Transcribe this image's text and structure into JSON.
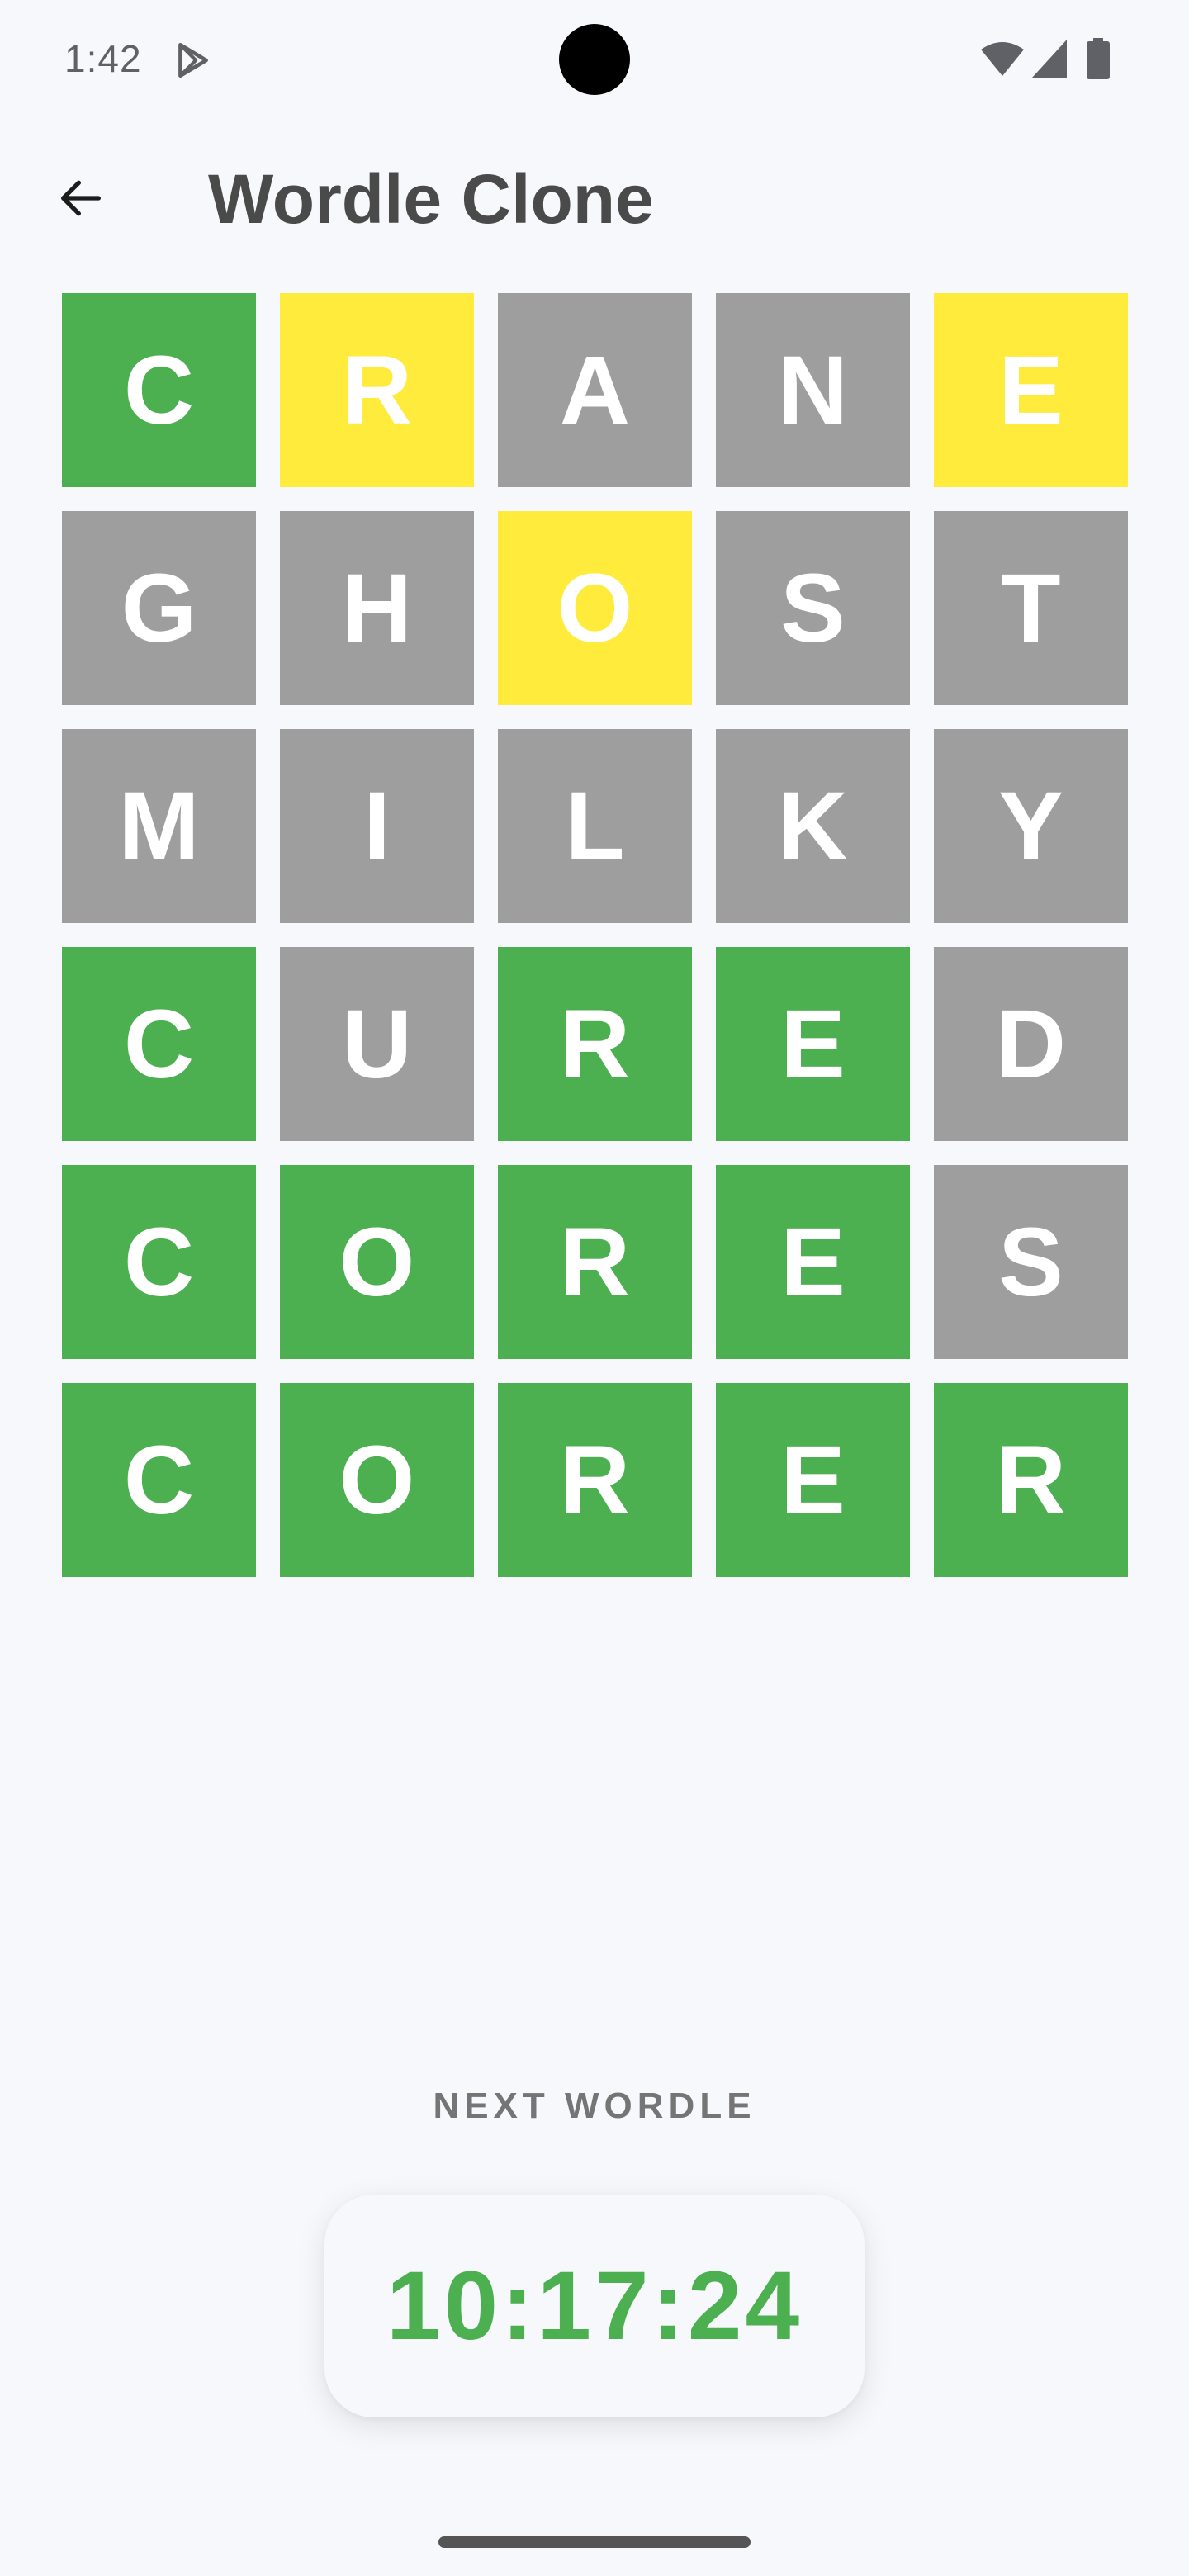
{
  "status_bar": {
    "time": "1:42",
    "icons": [
      "play-store-icon",
      "wifi-icon",
      "signal-icon",
      "battery-icon"
    ]
  },
  "app_bar": {
    "back_icon": "arrow-back-icon",
    "title": "Wordle Clone"
  },
  "colors": {
    "correct": "#4caf50",
    "present": "#ffeb3b",
    "absent": "#9e9e9e",
    "background": "#f7f8fc"
  },
  "board": {
    "rows": [
      [
        {
          "letter": "C",
          "state": "correct"
        },
        {
          "letter": "R",
          "state": "present"
        },
        {
          "letter": "A",
          "state": "absent"
        },
        {
          "letter": "N",
          "state": "absent"
        },
        {
          "letter": "E",
          "state": "present"
        }
      ],
      [
        {
          "letter": "G",
          "state": "absent"
        },
        {
          "letter": "H",
          "state": "absent"
        },
        {
          "letter": "O",
          "state": "present"
        },
        {
          "letter": "S",
          "state": "absent"
        },
        {
          "letter": "T",
          "state": "absent"
        }
      ],
      [
        {
          "letter": "M",
          "state": "absent"
        },
        {
          "letter": "I",
          "state": "absent"
        },
        {
          "letter": "L",
          "state": "absent"
        },
        {
          "letter": "K",
          "state": "absent"
        },
        {
          "letter": "Y",
          "state": "absent"
        }
      ],
      [
        {
          "letter": "C",
          "state": "correct"
        },
        {
          "letter": "U",
          "state": "absent"
        },
        {
          "letter": "R",
          "state": "correct"
        },
        {
          "letter": "E",
          "state": "correct"
        },
        {
          "letter": "D",
          "state": "absent"
        }
      ],
      [
        {
          "letter": "C",
          "state": "correct"
        },
        {
          "letter": "O",
          "state": "correct"
        },
        {
          "letter": "R",
          "state": "correct"
        },
        {
          "letter": "E",
          "state": "correct"
        },
        {
          "letter": "S",
          "state": "absent"
        }
      ],
      [
        {
          "letter": "C",
          "state": "correct"
        },
        {
          "letter": "O",
          "state": "correct"
        },
        {
          "letter": "R",
          "state": "correct"
        },
        {
          "letter": "E",
          "state": "correct"
        },
        {
          "letter": "R",
          "state": "correct"
        }
      ]
    ]
  },
  "next_wordle": {
    "label": "NEXT WORDLE",
    "countdown": "10:17:24"
  }
}
